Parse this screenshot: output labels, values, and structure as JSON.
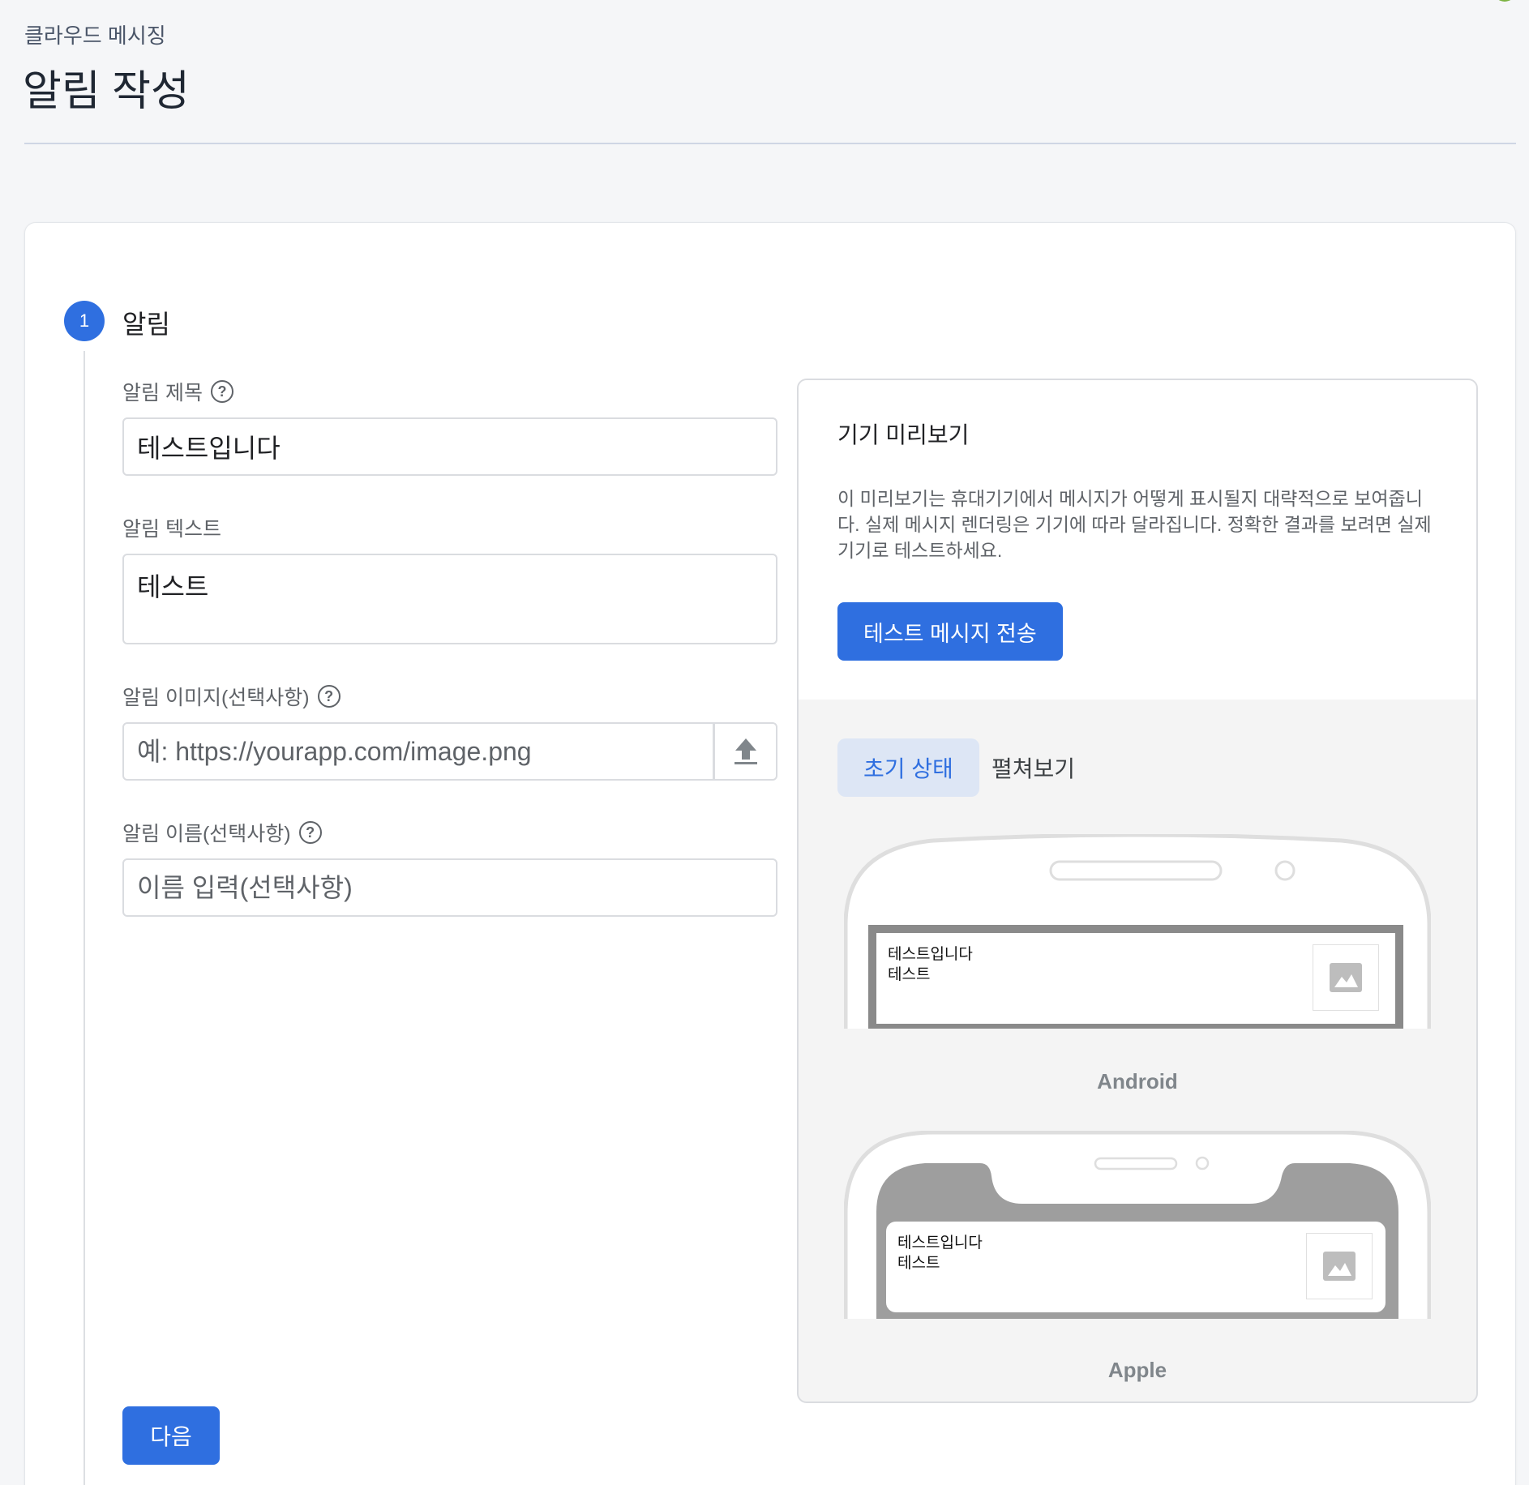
{
  "header": {
    "breadcrumb": "클라우드 메시징",
    "title": "알림 작성"
  },
  "step": {
    "number": "1",
    "title": "알림"
  },
  "form": {
    "title_label": "알림 제목",
    "title_value": "테스트입니다",
    "text_label": "알림 텍스트",
    "text_value": "테스트",
    "image_label": "알림 이미지(선택사항)",
    "image_placeholder": "예: https://yourapp.com/image.png",
    "name_label": "알림 이름(선택사항)",
    "name_placeholder": "이름 입력(선택사항)",
    "next_label": "다음"
  },
  "preview": {
    "title": "기기 미리보기",
    "description": "이 미리보기는 휴대기기에서 메시지가 어떻게 표시될지 대략적으로 보여줍니다. 실제 메시지 렌더링은 기기에 따라 달라집니다. 정확한 결과를 보려면 실제 기기로 테스트하세요.",
    "send_test_label": "테스트 메시지 전송",
    "tabs": [
      {
        "label": "초기 상태",
        "active": true
      },
      {
        "label": "펼쳐보기",
        "active": false
      }
    ],
    "android": {
      "label": "Android",
      "notif_title": "테스트입니다",
      "notif_body": "테스트"
    },
    "apple": {
      "label": "Apple",
      "notif_title": "테스트입니다",
      "notif_body": "테스트"
    }
  },
  "icons": [
    "help-icon",
    "upload-icon",
    "image-placeholder-icon"
  ],
  "colors": {
    "accent": "#2f6fe0",
    "tab_active_bg": "#dde6f5"
  }
}
